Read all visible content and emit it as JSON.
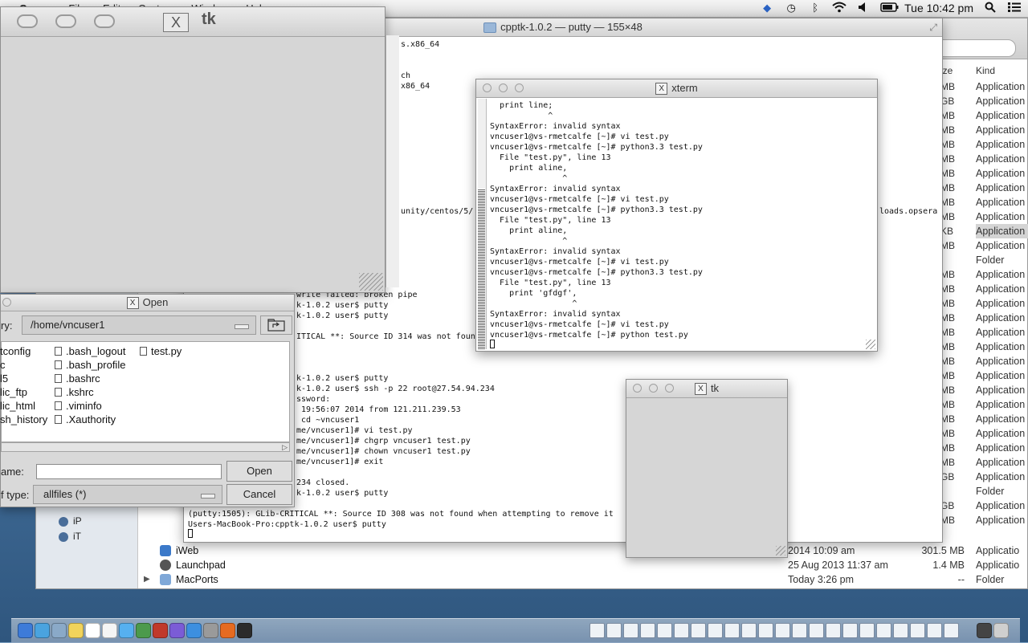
{
  "menubar": {
    "apple": "",
    "app_name": "Cocoa",
    "menus": [
      "File",
      "Edit",
      "Custom",
      "Window",
      "Help"
    ],
    "clock": "Tue 10:42 pm"
  },
  "finder": {
    "col_size": "ize",
    "col_kind": "Kind",
    "sidebar": [
      {
        "label": "iP"
      },
      {
        "label": "iT"
      }
    ],
    "size_column": [
      "MB",
      "GB",
      "MB",
      "MB",
      "MB",
      "MB",
      "MB",
      "MB",
      "MB",
      "MB",
      "KB",
      "MB",
      "",
      "MB",
      "MB",
      "MB",
      "MB",
      "MB",
      "MB",
      "MB",
      "MB",
      "MB",
      "MB",
      "MB",
      "MB",
      "MB",
      "MB",
      "GB",
      "",
      "GB",
      "MB"
    ],
    "kind_column": [
      "Application",
      "Application",
      "Application",
      "Application",
      "Application",
      "Application",
      "Application",
      "Application",
      "Application",
      "Application",
      "Application",
      "Application",
      "Folder",
      "Application",
      "Application",
      "Application",
      "Application",
      "Application",
      "Application",
      "Application",
      "Application",
      "Application",
      "Application",
      "Application",
      "Application",
      "Application",
      "Application",
      "Application",
      "Folder",
      "Application",
      "Application"
    ],
    "rows": [
      {
        "name": "iWeb",
        "date": "2014 10:09 am",
        "size": "301.5 MB",
        "kind": "Applicatio",
        "expand": ""
      },
      {
        "name": "Launchpad",
        "date": "25 Aug 2013 11:37 am",
        "size": "1.4 MB",
        "kind": "Applicatio",
        "expand": ""
      },
      {
        "name": "MacPorts",
        "date": "Today 3:26 pm",
        "size": "--",
        "kind": "Folder",
        "expand": "▶"
      }
    ],
    "folder_dash": "--"
  },
  "putty": {
    "title": "cpptk-1.0.2 — putty — 155×48",
    "lines_right": [
      {
        "text": "s.x86_64",
        "row": 0
      },
      {
        "text": "ch",
        "row": 3
      },
      {
        "text": "x86_64",
        "row": 4
      },
      {
        "text": "unity/centos/5/",
        "row": 16
      },
      {
        "text": "loads.opsera",
        "row": 16,
        "far": true
      }
    ],
    "lines_mid": [
      {
        "text": "write failed: broken pipe",
        "row": 24
      },
      {
        "text": "k-1.0.2 user$ putty",
        "row": 25
      },
      {
        "text": "k-1.0.2 user$ putty",
        "row": 26
      },
      {
        "text": "ITICAL **: Source ID 314 was not found",
        "row": 28
      },
      {
        "text": "k-1.0.2 user$ putty",
        "row": 32
      },
      {
        "text": "k-1.0.2 user$ ssh -p 22 root@27.54.94.234",
        "row": 33
      },
      {
        "text": "ssword:",
        "row": 34
      },
      {
        "text": " 19:56:07 2014 from 121.211.239.53",
        "row": 35
      },
      {
        "text": " cd ~vncuser1",
        "row": 36
      },
      {
        "text": "me/vncuser1]# vi test.py",
        "row": 37
      },
      {
        "text": "me/vncuser1]# chgrp vncuser1 test.py",
        "row": 38
      },
      {
        "text": "me/vncuser1]# chown vncuser1 test.py",
        "row": 39
      },
      {
        "text": "me/vncuser1]# exit",
        "row": 40
      },
      {
        "text": "234 closed.",
        "row": 42
      },
      {
        "text": "k-1.0.2 user$ putty",
        "row": 43
      }
    ],
    "lines_full": [
      {
        "text": "(putty:1505): GLib-CRITICAL **: Source ID 308 was not found when attempting to remove it",
        "row": 45
      },
      {
        "text": "Users-MacBook-Pro:cpptk-1.0.2 user$ putty",
        "row": 46
      }
    ]
  },
  "tk_big": {
    "title_x": "X",
    "title": "tk"
  },
  "open_dialog": {
    "title_x": "X",
    "title": "Open",
    "dir_label": "ry:",
    "directory": "/home/vncuser1",
    "up_icon": "⮤",
    "files": [
      {
        "name": "tconfig",
        "col": 0,
        "row": 0,
        "icon": false
      },
      {
        "name": "c",
        "col": 0,
        "row": 1,
        "icon": false
      },
      {
        "name": "l5",
        "col": 0,
        "row": 2,
        "icon": false
      },
      {
        "name": "lic_ftp",
        "col": 0,
        "row": 3,
        "icon": false
      },
      {
        "name": "lic_html",
        "col": 0,
        "row": 4,
        "icon": false
      },
      {
        "name": "sh_history",
        "col": 0,
        "row": 5,
        "icon": false
      },
      {
        "name": ".bash_logout",
        "col": 1,
        "row": 0,
        "icon": true
      },
      {
        "name": ".bash_profile",
        "col": 1,
        "row": 1,
        "icon": true
      },
      {
        "name": ".bashrc",
        "col": 1,
        "row": 2,
        "icon": true
      },
      {
        "name": ".kshrc",
        "col": 1,
        "row": 3,
        "icon": true
      },
      {
        "name": ".viminfo",
        "col": 1,
        "row": 4,
        "icon": true
      },
      {
        "name": ".Xauthority",
        "col": 1,
        "row": 5,
        "icon": true
      },
      {
        "name": "test.py",
        "col": 2,
        "row": 0,
        "icon": true
      }
    ],
    "filename_label": "ame:",
    "filename_value": "",
    "open_label": "Open",
    "type_label": "f type:",
    "type_value": "allfiles (*)",
    "cancel_label": "Cancel"
  },
  "xterm": {
    "title_x": "X",
    "title": "xterm",
    "lines": [
      "  print line;",
      "            ^",
      "SyntaxError: invalid syntax",
      "vncuser1@vs-rmetcalfe [~]# vi test.py",
      "vncuser1@vs-rmetcalfe [~]# python3.3 test.py",
      "  File \"test.py\", line 13",
      "    print aline,",
      "               ^",
      "SyntaxError: invalid syntax",
      "vncuser1@vs-rmetcalfe [~]# vi test.py",
      "vncuser1@vs-rmetcalfe [~]# python3.3 test.py",
      "  File \"test.py\", line 13",
      "    print aline,",
      "               ^",
      "SyntaxError: invalid syntax",
      "vncuser1@vs-rmetcalfe [~]# vi test.py",
      "vncuser1@vs-rmetcalfe [~]# python3.3 test.py",
      "  File \"test.py\", line 13",
      "    print 'gfdgf',",
      "                 ^",
      "SyntaxError: invalid syntax",
      "vncuser1@vs-rmetcalfe [~]# vi test.py",
      "vncuser1@vs-rmetcalfe [~]# python test.py"
    ]
  },
  "tk_small": {
    "title_x": "X",
    "title": "tk"
  },
  "dock": {
    "icons": [
      "finder-icon",
      "safari-icon",
      "mail-icon",
      "notes-icon",
      "calendar-icon",
      "reminders-icon",
      "messages-icon",
      "facetime-icon",
      "photo-booth-icon",
      "itunes-icon",
      "app-store-icon",
      "system-preferences-icon",
      "firefox-icon",
      "terminal-icon",
      "xquartz-icon",
      "trash-icon"
    ],
    "colors": [
      "#3d7bd9",
      "#4aa3df",
      "#8aa9c8",
      "#f1d35b",
      "#ffffff",
      "#f5f5f5",
      "#56b0f0",
      "#4c9a4c",
      "#c0392b",
      "#7b5cd6",
      "#3c8fe0",
      "#9a9a9a",
      "#e66b21",
      "#2b2b2b",
      "#444444",
      "#cfcfcf"
    ]
  }
}
